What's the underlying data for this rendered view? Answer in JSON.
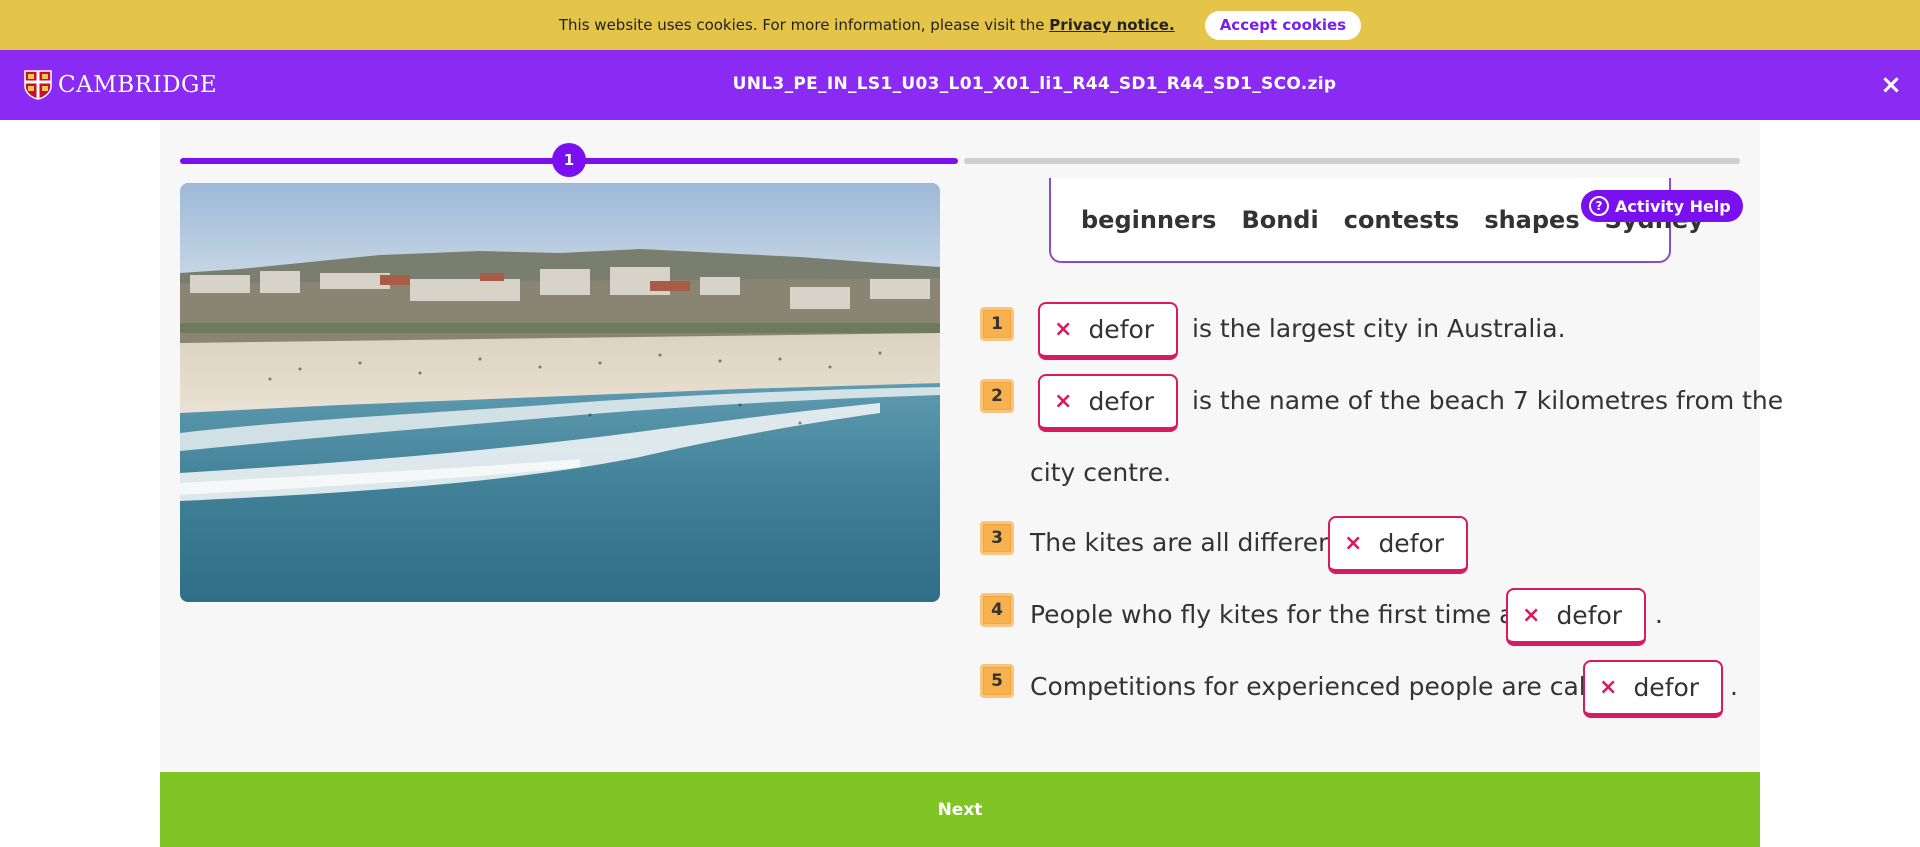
{
  "cookie": {
    "text": "This website uses cookies. For more information, please visit the",
    "link": "Privacy notice.",
    "accept_label": "Accept cookies"
  },
  "header": {
    "logo_text": "CAMBRIDGE",
    "file_title": "UNL3_PE_IN_LS1_U03_L01_X01_li1_R44_SD1_R44_SD1_SCO.zip",
    "close_icon": "×"
  },
  "progress": {
    "current_step": "1",
    "fraction_complete": 0.5
  },
  "word_bank": [
    "beginners",
    "Bondi",
    "contests",
    "shapes",
    "Sydney"
  ],
  "help_label": "Activity Help",
  "questions": [
    {
      "num": "1",
      "before": "",
      "answer": "defor",
      "after": "is the largest city in Australia."
    },
    {
      "num": "2",
      "before": "",
      "answer": "defor",
      "after": "is the name of the beach 7 kilometres from the",
      "after2": "city centre."
    },
    {
      "num": "3",
      "before": "The kites are all different",
      "answer": "defor",
      "after": ""
    },
    {
      "num": "4",
      "before": "People who fly kites for the first time are",
      "answer": "defor",
      "after": "."
    },
    {
      "num": "5",
      "before": "Competitions for experienced people are called",
      "answer": "defor",
      "after": "."
    }
  ],
  "answer_status_icon": "×",
  "next_label": "Next",
  "colors": {
    "cookie_bar": "#e5c44a",
    "header": "#8a2bf4",
    "progress": "#7a0ff0",
    "wrong_answer": "#d81b60",
    "number_badge": "#f5a33b",
    "next_bar": "#80c426"
  }
}
